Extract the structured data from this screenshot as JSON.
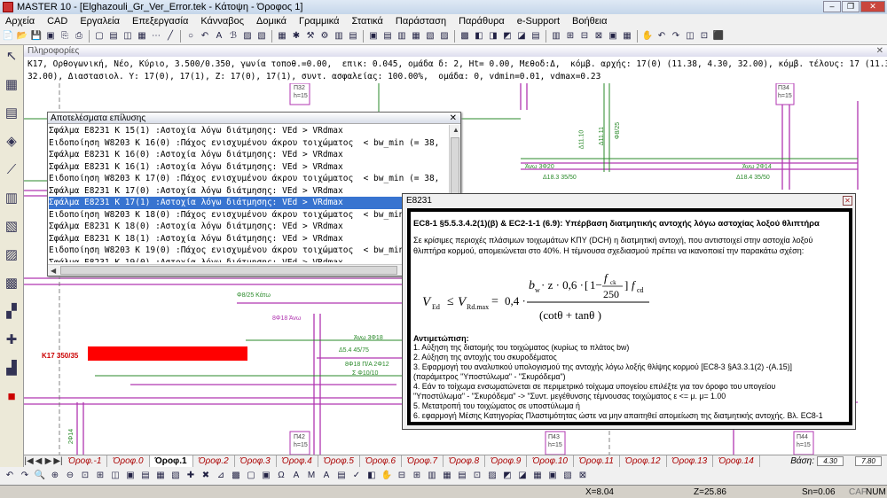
{
  "window": {
    "title": "MASTER 10 - [Elghazouli_Gr_Ver_Error.tek - Κάτοψη - Όροφος 1]"
  },
  "menu": [
    "Αρχεία",
    "CAD",
    "Εργαλεία",
    "Επεξεργασία",
    "Κάνναβος",
    "Δομικά",
    "Γραμμικά",
    "Στατικά",
    "Παράσταση",
    "Παράθυρα",
    "e-Support",
    "Βοήθεια"
  ],
  "info": {
    "title": "Πληροφορίες",
    "line1": "K17, Ορθογωνική, Νέο, Κύριο, 3.500/0.350, γωνία τοποθ.=0.00,  επικ: 0.045, ομάδα δ: 2, Ht= 0.00, Μεθοδ:Δ,  κόμβ. αρχής: 17(0) (11.38, 4.30, 32.00), κόμβ. τέλους: 17 (11.38, 7.80,",
    "line2": "32.00), Διαστασιολ. Y: 17(0), 17(1), Z: 17(0), 17(1), συντ. ασφαλείας: 100.00%,  ομάδα: 0, vdmin=0.01, vdmax=0.23"
  },
  "errors": {
    "title": "Αποτελέσματα επίλυσης",
    "rows": [
      "Σφάλμα E8231 K 15(1) :Αστοχία λόγω διάτμησης: VEd > VRdmax",
      "Ειδοποίηση W8203 K 16(0) :Πάχος ενισχυμένου άκρου τοιχώματος  < bw_min (= 38,",
      "Σφάλμα E8231 K 16(0) :Αστοχία λόγω διάτμησης: VEd > VRdmax",
      "Σφάλμα E8231 K 16(1) :Αστοχία λόγω διάτμησης: VEd > VRdmax",
      "Ειδοποίηση W8203 K 17(0) :Πάχος ενισχυμένου άκρου τοιχώματος  < bw_min (= 38,",
      "Σφάλμα E8231 K 17(0) :Αστοχία λόγω διάτμησης: VEd > VRdmax",
      "Σφάλμα E8231 K 17(1) :Αστοχία λόγω διάτμησης: VEd > VRdmax",
      "Ειδοποίηση W8203 K 18(0) :Πάχος ενισχυμένου άκρου τοιχώματος  < bw_min (= 38,",
      "Σφάλμα E8231 K 18(0) :Αστοχία λόγω διάτμησης: VEd > VRdmax",
      "Σφάλμα E8231 K 18(1) :Αστοχία λόγω διάτμησης: VEd > VRdmax",
      "Ειδοποίηση W8203 K 19(0) :Πάχος ενισχυμένου άκρου τοιχώματος  < bw_min (= 38,",
      "Σφάλμα E8231 K 19(0) :Αστοχία λόγω διάτμησης: VEd > VRdmax"
    ],
    "selected_index": 6
  },
  "dialog": {
    "title": "E8231",
    "heading": "EC8-1 §5.5.3.4.2(1)(β) & EC2-1-1 (6.9): Υπέρβαση διατμητικής αντοχής λόγω αστοχίας λοξού θλιπτήρα",
    "intro": "Σε κρίσιμες περιοχές πλάσιμων τοιχωμάτων ΚΠΥ (DCH) η διατμητική αντοχή, που αντιστοιχεί στην αστοχία λοξού θλιπτήρα κορμού, απομειώνεται στο 40%. Η τέμνουσα σχεδιασμού πρέπει να ικανοποιεί την παρακάτω σχέση:",
    "formula": {
      "v_ed": "V",
      "v_ed_sub": "Ed",
      "leq": "≤",
      "v_rd": "V",
      "v_rd_sub": "Rd.max",
      "eq": "=",
      "coef": "0,4 ·",
      "numerator": "b",
      "num_sub": "w",
      "num_rest": "· z · 0,6 ·",
      "bracket_one": "1−",
      "f": "f",
      "f_sub": "ck",
      "div": "250",
      "fcd": "f",
      "fcd_sub": "cd",
      "denominator": "(cotθ  +  tanθ )"
    },
    "remedies_title": "Αντιμετώπιση:",
    "remedies": [
      "1. Αύξηση της διατομής του τοιχώματος (κυρίως το πλάτος bw)",
      "2. Αύξηση της αντοχής του σκυροδέματος",
      "3. Εφαρμογή του αναλυτικού υπολογισμού της αντοχής λόγω λοξής θλίψης κορμού [EC8-3 §A3.3.1(2) -(A.15)]",
      "(παράμετρος \"Υποστύλωμα\" - \"Σκυρόδεμα\")",
      "4. Εάν το τοίχωμα ενσωματώνεται σε περιμετρικό τοίχωμα υπογείου επιλέξτε για τον όροφο του υπογείου",
      "\"Υποστύλωμα\" - \"Σκυρόδεμα\" -> \"Συντ. μεγέθυνσης τέμνουσας τοιχώματος ε <= μ. μ= 1.00",
      "5. Μετατροπή του τοιχώματος σε υποστύλωμα ή",
      "6. εφαρμογή Μέσης Κατηγορίας Πλαστιμότητας ώστε να μην απαιτηθεί απομείωση της διατμητικής αντοχής. Βλ. EC8-1",
      "§5.4.3.4.1(1)A"
    ]
  },
  "canvas_labels": {
    "wall": "K17 350/35",
    "p32": "Π32",
    "p32h": "h=15",
    "p34": "Π34",
    "p34h": "h=15",
    "p42": "Π42",
    "p42h": "h=15",
    "p43": "Π43",
    "p43h": "h=15",
    "p44": "Π44",
    "p44h": "h=15",
    "ano3f20": "Άνω 3Φ20",
    "d18": "Δ18.3  35/50",
    "ano2f14": "Άνω 2Φ14",
    "d184": "Δ18.4  35/50",
    "f825": "Φ8/25 Κάτω",
    "f818": "8Φ18 Άνω",
    "ano3f18": "Άνω 3Φ18",
    "d54": "Δ5.4  45/75",
    "f818p": "8Φ18 Π/Α  2Φ12",
    "sf10": "Σ Φ10/10",
    "d1110": "Δ11.10",
    "d1111": "Δ11.11",
    "f825b": "Φ8/25",
    "k": "Κάτω",
    "f14": "2Φ14",
    "a": "Άνω"
  },
  "floors": {
    "items": [
      "Όροφ.-1",
      "Όροφ.0",
      "Όροφ.1",
      "Όροφ.2",
      "Όροφ.3",
      "Όροφ.4",
      "Όροφ.5",
      "Όροφ.6",
      "Όροφ.7",
      "Όροφ.8",
      "Όροφ.9",
      "Όροφ.10",
      "Όροφ.11",
      "Όροφ.12",
      "Όροφ.13",
      "Όροφ.14"
    ],
    "active_index": 2,
    "base_label": "Βάση:",
    "base_value": "4.30",
    "top_value": "7.80"
  },
  "status": {
    "x": "X=8.04",
    "z": "Z=25.86",
    "sn": "Sn=0.06",
    "caf": "CAF",
    "num": "NUM"
  }
}
